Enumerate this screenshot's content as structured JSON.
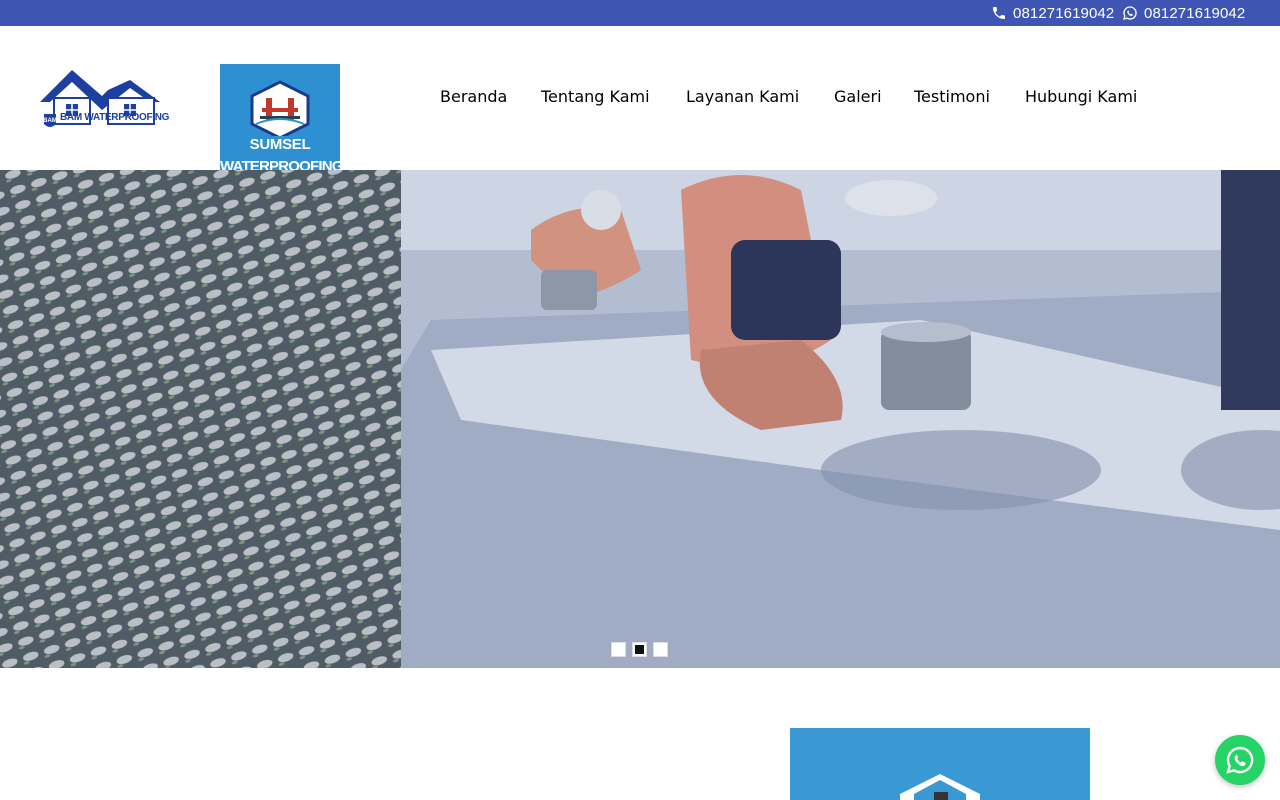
{
  "topbar": {
    "phone_number": "081271619042",
    "whatsapp_number": "081271619042",
    "background_color": "#3f55b3"
  },
  "brand": {
    "bam_logo_text": "BAM WATERPROOFING",
    "sumsel_line1": "SUMSEL",
    "sumsel_line2": "WATERPROOFING",
    "accent_color": "#2f90d1"
  },
  "nav": {
    "items": [
      {
        "label": "Beranda"
      },
      {
        "label": "Tentang Kami"
      },
      {
        "label": "Layanan Kami"
      },
      {
        "label": "Galeri"
      },
      {
        "label": "Testimoni"
      },
      {
        "label": "Hubungi Kami"
      }
    ]
  },
  "hero": {
    "slide_count": 3,
    "active_slide": 2
  },
  "icons": {
    "phone": "phone-icon",
    "whatsapp": "whatsapp-icon",
    "floating_whatsapp": "whatsapp-chat-icon"
  }
}
